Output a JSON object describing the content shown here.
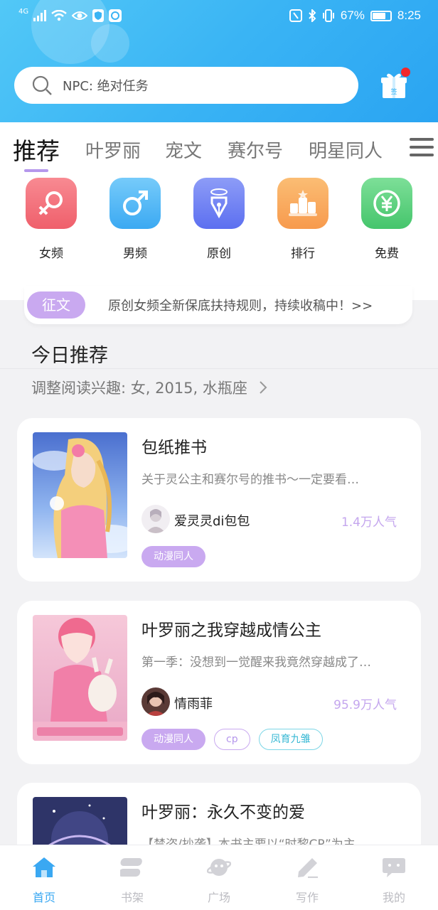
{
  "status_bar": {
    "network": "4G",
    "battery": "67%",
    "time": "8:25"
  },
  "search": {
    "placeholder": "NPC: 绝对任务"
  },
  "tabs": [
    {
      "label": "推荐",
      "active": true
    },
    {
      "label": "叶罗丽"
    },
    {
      "label": "宠文"
    },
    {
      "label": "赛尔号"
    },
    {
      "label": "明星同人"
    }
  ],
  "categories": [
    {
      "label": "女频",
      "icon": "female-symbol-icon",
      "color": "#f2727d"
    },
    {
      "label": "男频",
      "icon": "male-symbol-icon",
      "color": "#4fb6f4"
    },
    {
      "label": "原创",
      "icon": "pen-nib-icon",
      "color": "#6a7ff3"
    },
    {
      "label": "排行",
      "icon": "podium-icon",
      "color": "#f8a45a"
    },
    {
      "label": "免费",
      "icon": "yuan-icon",
      "color": "#56d07d"
    }
  ],
  "notice": {
    "badge": "征文",
    "text": "原创女频全新保底扶持规则，持续收稿中！>>"
  },
  "section": {
    "title": "今日推荐",
    "subtitle": "调整阅读兴趣: 女, 2015, 水瓶座"
  },
  "books": [
    {
      "title": "包纸推书",
      "desc": "关于灵公主和赛尔号的推书～一定要看…",
      "author": "爱灵灵di包包",
      "popularity": "1.4万人气",
      "tags": [
        "动漫同人"
      ]
    },
    {
      "title": "叶罗丽之我穿越成情公主",
      "desc": "第一季：没想到一觉醒来我竟然穿越成了…",
      "author": "情雨菲",
      "popularity": "95.9万人气",
      "tags": [
        "动漫同人",
        "cp",
        "凤育九雏"
      ]
    },
    {
      "title": "叶罗丽：永久不变的爱",
      "desc": "【禁盗/抄袭】本书主要以“时黎CP”为主…"
    }
  ],
  "bottom_nav": [
    {
      "label": "首页",
      "icon": "home-icon",
      "active": true
    },
    {
      "label": "书架",
      "icon": "bookshelf-icon"
    },
    {
      "label": "广场",
      "icon": "planet-icon"
    },
    {
      "label": "写作",
      "icon": "pencil-icon"
    },
    {
      "label": "我的",
      "icon": "chat-bubble-icon"
    }
  ],
  "colors": {
    "header": "#3ab4f4",
    "accent_purple": "#c9a9f0",
    "accent_blue": "#3aa8f2",
    "badge_red": "#f2272c"
  }
}
